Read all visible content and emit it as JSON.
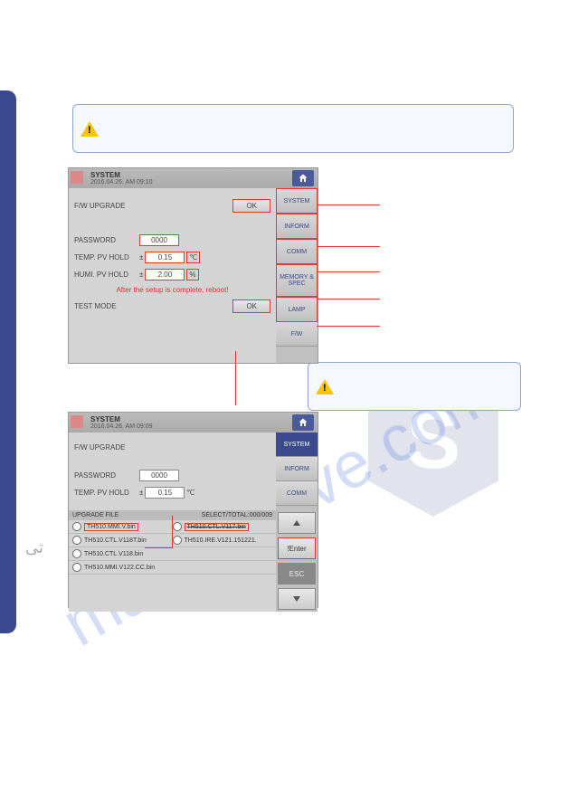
{
  "watermark": "manualslive.com",
  "arabic_bg": "تی",
  "note_boxes": {
    "n1": "",
    "n2": ""
  },
  "panel1": {
    "title": "SYSTEM",
    "date": "2016.04.26. AM 09:10",
    "rows": {
      "fw_upgrade": {
        "label": "F/W UPGRADE",
        "btn": "OK"
      },
      "password": {
        "label": "PASSWORD",
        "value": "0000"
      },
      "temp_hold": {
        "label": "TEMP. PV HOLD",
        "pm": "±",
        "value": "0.15",
        "unit": "℃"
      },
      "humi_hold": {
        "label": "HUMI. PV HOLD",
        "pm": "±",
        "value": "2.00",
        "unit": "%"
      },
      "warning": "After the setup is complete, reboot!",
      "test_mode": {
        "label": "TEST MODE",
        "btn": "OK"
      }
    },
    "side": [
      "SYSTEM",
      "INFORM",
      "COMM",
      "MEMORY & SPEC",
      "LAMP",
      "F/W"
    ]
  },
  "panel2": {
    "title": "SYSTEM",
    "date": "2016.04.26. AM 09:09",
    "rows": {
      "fw_upgrade": {
        "label": "F/W UPGRADE"
      },
      "password": {
        "label": "PASSWORD",
        "value": "0000"
      },
      "temp_hold": {
        "label": "TEMP. PV HOLD",
        "pm": "±",
        "value": "0.15",
        "unit": "℃"
      }
    },
    "file_header": {
      "label": "UPGRADE FILE",
      "count": "SELECT/TOTAL:000/009"
    },
    "files": [
      [
        "TH510.MMI.V.bin",
        "TH510.CTL.V117.bin"
      ],
      [
        "TH510.CTL.V118T.bin",
        "TH510.IRE.V121.151221."
      ],
      [
        "TH510.CTL.V118.bin",
        ""
      ],
      [
        "TH510.MMI.V122.CC.bin",
        ""
      ]
    ],
    "side": [
      "SYSTEM",
      "INFORM",
      "COMM"
    ],
    "enter": "!Enter",
    "esc": "ESC"
  }
}
